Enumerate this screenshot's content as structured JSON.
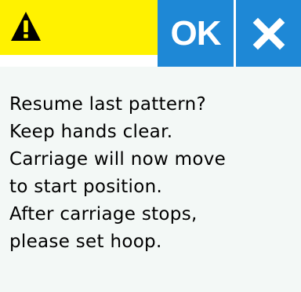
{
  "header": {
    "warning_icon": "warning-icon",
    "ok_label": "OK",
    "close_icon": "close-icon",
    "colors": {
      "warning": "#fff200",
      "button": "#1e88d6",
      "background": "#f3f8f6"
    }
  },
  "message": {
    "lines": [
      "Resume last pattern?",
      "Keep hands clear.",
      "Carriage will now move",
      "to start position.",
      "After carriage stops,",
      "please set hoop."
    ]
  }
}
